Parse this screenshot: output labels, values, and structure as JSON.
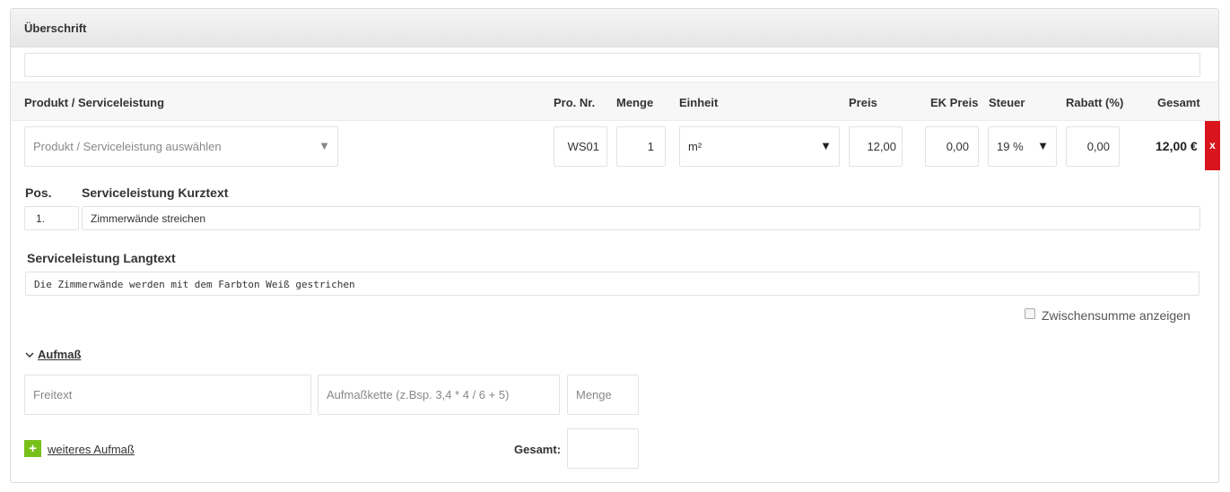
{
  "header": {
    "title": "Überschrift",
    "input_value": ""
  },
  "columns": {
    "product": "Produkt / Serviceleistung",
    "pro_nr": "Pro. Nr.",
    "menge": "Menge",
    "einheit": "Einheit",
    "preis": "Preis",
    "ek_preis": "EK Preis",
    "steuer": "Steuer",
    "rabatt": "Rabatt (%)",
    "gesamt": "Gesamt"
  },
  "row": {
    "product_placeholder": "Produkt / Serviceleistung auswählen",
    "pro_nr": "WS01",
    "menge": "1",
    "einheit": "m²",
    "preis": "12,00",
    "ek_preis": "0,00",
    "steuer": "19 %",
    "rabatt": "0,00",
    "gesamt": "12,00 €",
    "delete_label": "x"
  },
  "position": {
    "pos_label": "Pos.",
    "pos_value": "1.",
    "kurztext_label": "Serviceleistung Kurztext",
    "kurztext_value": "Zimmerwände streichen",
    "langtext_label": "Serviceleistung Langtext",
    "langtext_value": "Die Zimmerwände werden mit dem Farbton Weiß gestrichen"
  },
  "subtotal": {
    "label": "Zwischensumme anzeigen",
    "checked": false
  },
  "aufmass": {
    "toggle_label": "Aufmaß",
    "freitext_placeholder": "Freitext",
    "kette_placeholder": "Aufmaßkette (z.Bsp. 3,4 * 4 / 6 + 5)",
    "menge_placeholder": "Menge",
    "add_label": "weiteres Aufmaß",
    "add_icon": "+",
    "gesamt_label": "Gesamt:",
    "gesamt_value": ""
  },
  "icons": {
    "dropdown": "triangle-down",
    "collapse": "chevron-down",
    "add": "plus-square",
    "delete": "close-x"
  },
  "colors": {
    "delete": "#d9141d",
    "add": "#77c01a"
  }
}
